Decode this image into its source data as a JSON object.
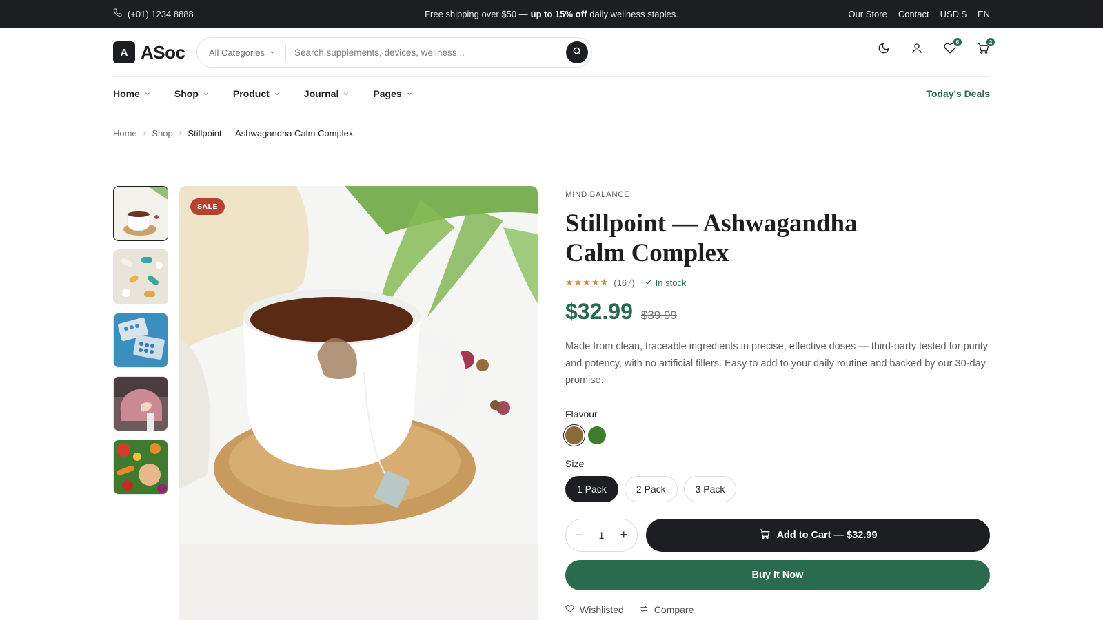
{
  "topbar": {
    "phone": "(+01) 1234 8888",
    "promo_pre": "Free shipping over $50 —",
    "promo_bold": "up to 15% off",
    "promo_post": "daily wellness staples.",
    "links": [
      "Our Store",
      "Contact",
      "USD $",
      "EN"
    ]
  },
  "header": {
    "logo_mark": "A",
    "logo_text": "ASoc",
    "category": "All Categories",
    "search_placeholder": "Search supplements, devices, wellness...",
    "wishlist_count": "6",
    "cart_count": "2"
  },
  "nav": {
    "items": [
      "Home",
      "Shop",
      "Product",
      "Journal",
      "Pages"
    ],
    "deals": "Today's Deals"
  },
  "breadcrumb": [
    "Home",
    "Shop",
    "Stillpoint — Ashwagandha Calm Complex"
  ],
  "gallery": {
    "sale_badge": "SALE",
    "thumbnails": [
      "tea-cup",
      "capsules",
      "blister-packs",
      "brain-model",
      "vegetables"
    ]
  },
  "product": {
    "category": "MIND BALANCE",
    "title": "Stillpoint — Ashwagandha Calm Complex",
    "stars": "★★★★★",
    "reviews": "(167)",
    "stock": "In stock",
    "price": "$32.99",
    "old_price": "$39.99",
    "description": "Made from clean, traceable ingredients in precise, effective doses — third-party tested for purity and potency, with no artificial fillers. Easy to add to your daily routine and backed by our 30-day promise.",
    "flavour_label": "Flavour",
    "flavours": [
      {
        "color": "#8a6a3a",
        "selected": true
      },
      {
        "color": "#3c7d2c",
        "selected": false
      }
    ],
    "size_label": "Size",
    "sizes": [
      "1 Pack",
      "2 Pack",
      "3 Pack"
    ],
    "selected_size": "1 Pack",
    "quantity": "1",
    "add_to_cart": "Add to Cart — $32.99",
    "buy_now": "Buy It Now",
    "wishlisted": "Wishlisted",
    "compare": "Compare"
  },
  "colors": {
    "dark": "#1c1e21",
    "accent_green": "#2a6b4f",
    "sale_red": "#b5432f",
    "star": "#d4893a"
  }
}
